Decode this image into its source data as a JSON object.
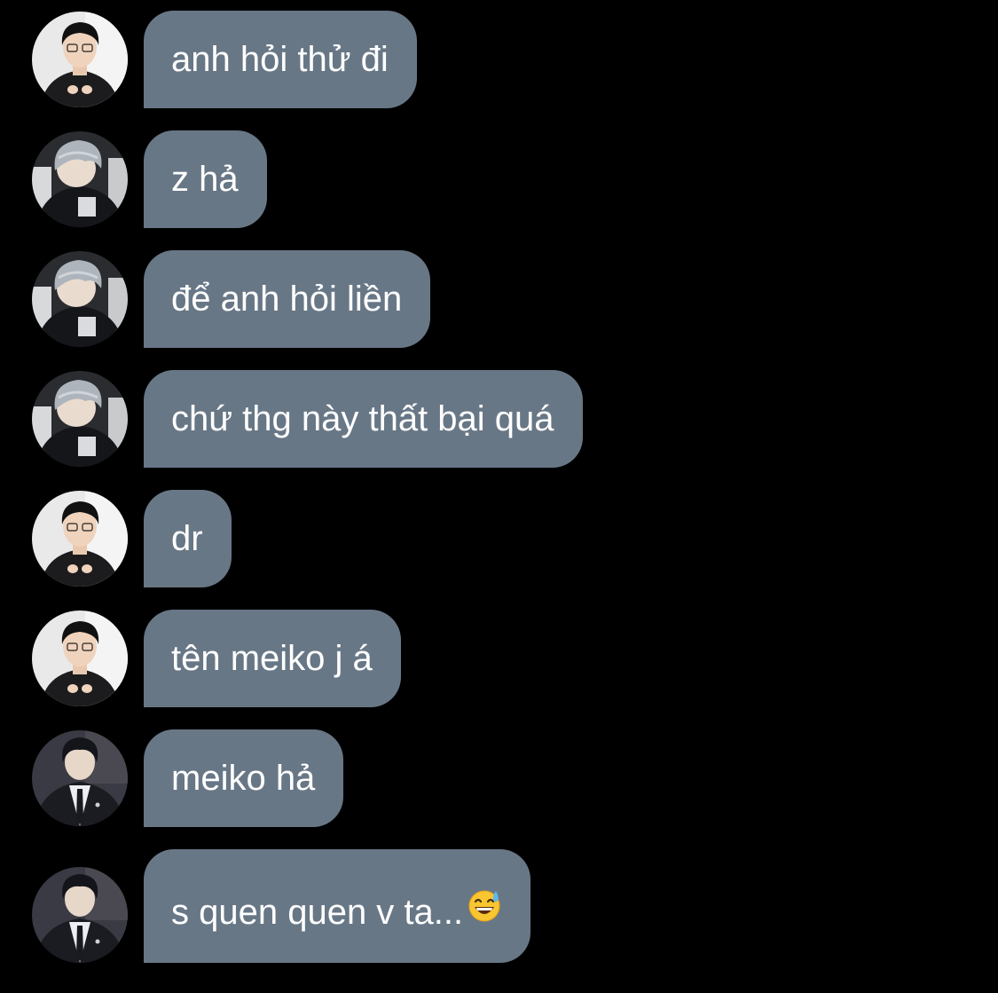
{
  "colors": {
    "background": "#000000",
    "bubble": "#687786",
    "text": "#ffffff"
  },
  "messages": [
    {
      "avatar": "avatar-boy-glasses",
      "text": "anh hỏi thử đi"
    },
    {
      "avatar": "avatar-gray-hair",
      "text": "z hả"
    },
    {
      "avatar": "avatar-gray-hair",
      "text": "để anh hỏi liền"
    },
    {
      "avatar": "avatar-gray-hair",
      "text": "chứ thg này thất bại quá"
    },
    {
      "avatar": "avatar-boy-glasses",
      "text": "dr"
    },
    {
      "avatar": "avatar-boy-glasses",
      "text": "tên meiko j á"
    },
    {
      "avatar": "avatar-suit",
      "text": "meiko hả"
    },
    {
      "avatar": "avatar-suit",
      "text": "s quen quen v ta...",
      "emoji": "grinning-sweat-emoji"
    }
  ]
}
